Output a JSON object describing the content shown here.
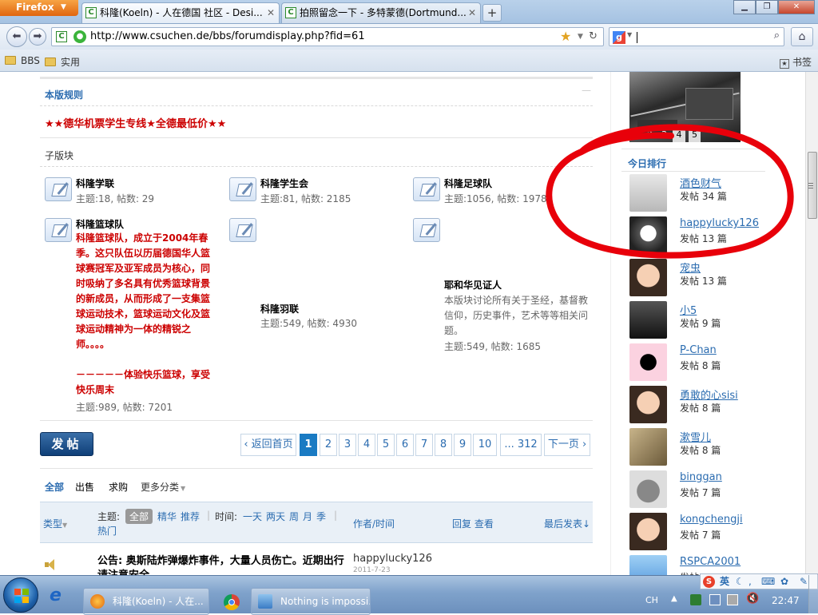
{
  "browser": {
    "app_button": "Firefox",
    "tabs": [
      {
        "title": "科隆(Koeln) - 人在德国 社区 - Desi..."
      },
      {
        "title": "拍照留念一下 - 多特蒙德(Dortmund..."
      }
    ],
    "url": "http://www.csuchen.de/bbs/forumdisplay.php?fid=61",
    "bookmarks": [
      "BBS",
      "实用"
    ],
    "bookmarks_right": "书签"
  },
  "forum": {
    "rules_title": "本版规则",
    "announcement": "★★德华机票学生专线★全德最低价★★",
    "subforums_title": "子版块",
    "subforums": [
      {
        "name": "科隆学联",
        "stats": "主题:18, 帖数: 29"
      },
      {
        "name": "科隆学生会",
        "stats": "主题:81, 帖数: 2185"
      },
      {
        "name": "科隆足球队",
        "stats": "主题:1056, 帖数: 19782"
      },
      {
        "name": "科隆篮球队",
        "desc": "科隆篮球队，成立于2004年春季。这只队伍以历届德国华人篮球赛冠军及亚军成员为核心，同时吸纳了多名具有优秀篮球背景的新成员，从而形成了一支集篮球运动技术，篮球运动文化及篮球运动精神为一体的精锐之师。。。。",
        "desc_lines": [
          "科隆篮球队，成立于2004年春",
          "季。这只队伍以历届德国华人篮",
          "球赛冠军及亚军成员为核心，同",
          "时吸纳了多名具有优秀篮球背景",
          "的新成员，从而形成了一支集篮",
          "球运动技术，篮球运动文化及篮",
          "球运动精神为一体的精锐之",
          "师。。。。"
        ],
        "desc2_lines": [
          "－－－－－体验快乐篮球，享受",
          "快乐周末"
        ],
        "stats": "主题:989, 帖数: 7201"
      },
      {
        "name": "科隆羽联",
        "stats": "主题:549, 帖数: 4930"
      },
      {
        "name": "耶和华见证人",
        "desc_lines": [
          "本版块讨论所有关于圣经，基督教",
          "信仰，历史事件，艺术等等相关问",
          "题。"
        ],
        "stats": "主题:549, 帖数: 1685"
      }
    ],
    "post_button": "发帖",
    "pagination": {
      "home": "返回首页",
      "pages": [
        "1",
        "2",
        "3",
        "4",
        "5",
        "6",
        "7",
        "8",
        "9",
        "10"
      ],
      "current": "1",
      "last": "... 312",
      "next": "下一页"
    },
    "filters": {
      "all": "全部",
      "sell": "出售",
      "buy": "求购",
      "more": "更多分类"
    },
    "header": {
      "type": "类型",
      "topic_label": "主题:",
      "topic_all": "全部",
      "digest": "精华",
      "recommend": "推荐",
      "hot": "热门",
      "time_label": "时间:",
      "time_options": [
        "一天",
        "两天",
        "周",
        "月",
        "季"
      ],
      "author": "作者/时间",
      "replies": "回复 查看",
      "last": "最后发表"
    },
    "thread": {
      "title_line1": "公告: 奥斯陆炸弹爆炸事件，大量人员伤亡。近期出行",
      "title_line2": "请注意安全",
      "author": "happylucky126",
      "date": "2011-7-23"
    }
  },
  "sidebar": {
    "pager": [
      "1",
      "2",
      "3",
      "4",
      "5"
    ],
    "title": "今日排行",
    "ranking": [
      {
        "user": "酒色财气",
        "count": "发帖 34 篇"
      },
      {
        "user": "happylucky126",
        "count": "发帖 13 篇"
      },
      {
        "user": "宠虫",
        "count": "发帖 13 篇"
      },
      {
        "user": "小5",
        "count": "发帖 9 篇"
      },
      {
        "user": "P-Chan",
        "count": "发帖 8 篇"
      },
      {
        "user": "勇敢的心sisi",
        "count": "发帖 8 篇"
      },
      {
        "user": "漱雪儿",
        "count": "发帖 8 篇"
      },
      {
        "user": "binggan",
        "count": "发帖 7 篇"
      },
      {
        "user": "kongchengji",
        "count": "发帖 7 篇"
      },
      {
        "user": "RSPCA2001",
        "count": "发帖"
      }
    ]
  },
  "taskbar": {
    "items": [
      {
        "label": "科隆(Koeln) - 人在..."
      },
      {
        "label": "Nothing is impossi..."
      }
    ],
    "lang": "CH",
    "time": "22:47",
    "ime": "英"
  },
  "colors": {
    "link": "#2b6cb0",
    "red": "#cc0000",
    "circle": "#e8000a"
  }
}
